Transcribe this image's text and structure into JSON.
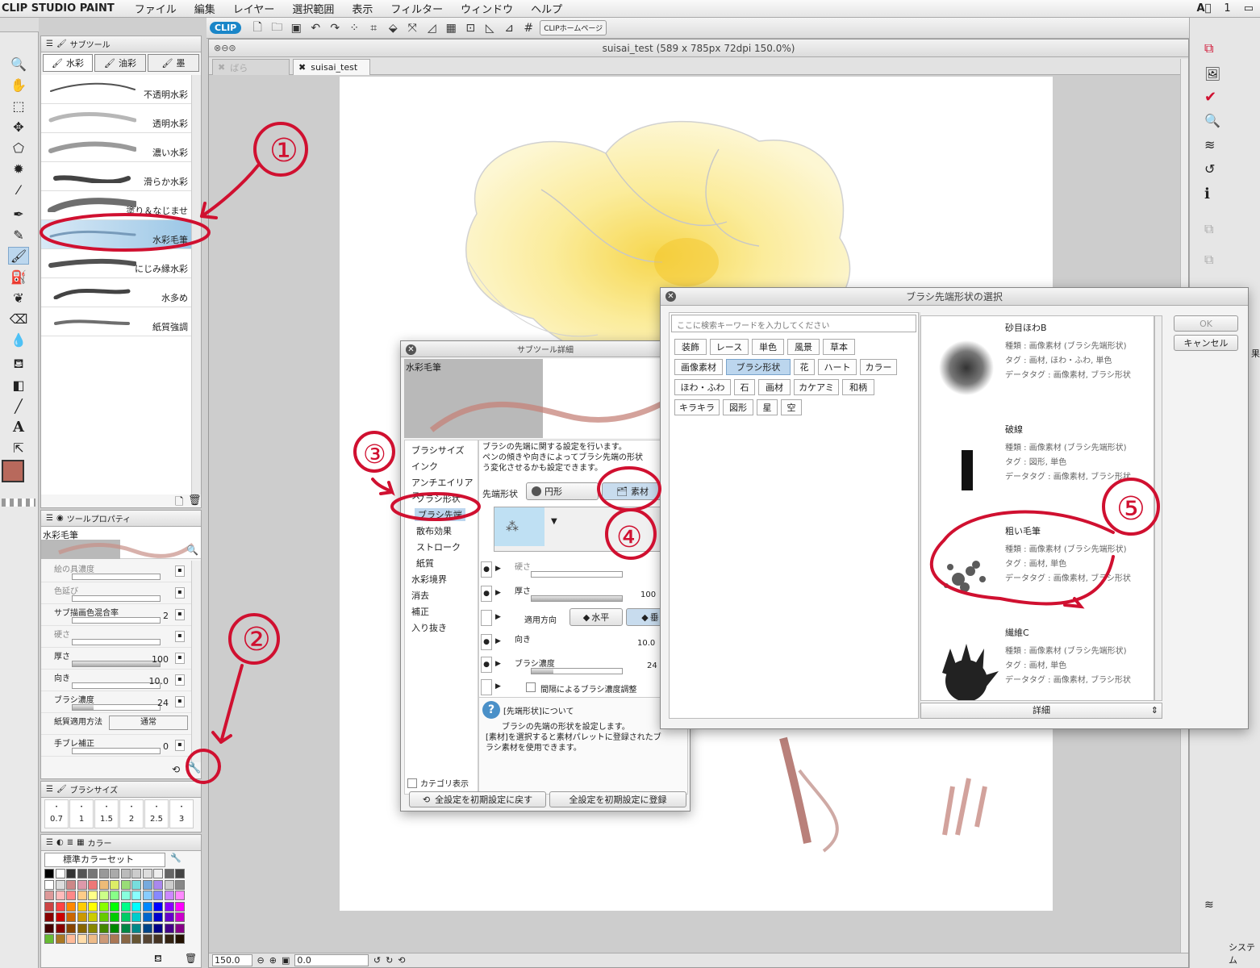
{
  "menubar": {
    "app": "CLIP STUDIO PAINT",
    "items": [
      "ファイル",
      "編集",
      "レイヤー",
      "選択範囲",
      "表示",
      "フィルター",
      "ウィンドウ",
      "ヘルプ"
    ],
    "right_indicator": "1"
  },
  "toolbar": {
    "clip_label": "CLIP",
    "homepage_label": "CLIPホームページ"
  },
  "subtool_panel": {
    "title": "サブツール",
    "groups": [
      "水彩",
      "油彩",
      "墨"
    ],
    "brushes": [
      "不透明水彩",
      "透明水彩",
      "濃い水彩",
      "滑らか水彩",
      "塗り＆なじませ",
      "水彩毛筆",
      "にじみ縁水彩",
      "水多め",
      "紙質強調"
    ],
    "selected_brush": "水彩毛筆"
  },
  "tool_property": {
    "title": "ツールプロパティ",
    "preview_name": "水彩毛筆",
    "rows": [
      {
        "label": "絵の具濃度",
        "value": ""
      },
      {
        "label": "色延び",
        "value": ""
      },
      {
        "label": "サブ描画色混合率",
        "value": "2"
      },
      {
        "label": "硬さ",
        "value": ""
      },
      {
        "label": "厚さ",
        "value": "100"
      },
      {
        "label": "向き",
        "value": "10.0"
      },
      {
        "label": "ブラシ濃度",
        "value": "24"
      },
      {
        "label": "紙質適用方法",
        "value": "通常"
      },
      {
        "label": "手ブレ補正",
        "value": "0"
      }
    ]
  },
  "brush_size_panel": {
    "title": "ブラシサイズ",
    "sizes": [
      "0.7",
      "1",
      "1.5",
      "2",
      "2.5",
      "3"
    ]
  },
  "color_panel": {
    "tab": "カラー",
    "set_name": "標準カラーセット"
  },
  "document": {
    "title": "suisai_test (589 x 785px 72dpi 150.0%)",
    "tabs": [
      "ばら",
      "suisai_test"
    ],
    "zoom": "150.0",
    "angle": "0.0"
  },
  "subtool_detail": {
    "title": "サブツール詳細",
    "preview_name": "水彩毛筆",
    "categories": [
      "ブラシサイズ",
      "インク",
      "アンチエイリアス",
      "ブラシ形状",
      "ブラシ先端",
      "散布効果",
      "ストローク",
      "紙質",
      "水彩境界",
      "消去",
      "補正",
      "入り抜き"
    ],
    "selected_category": "ブラシ先端",
    "description": [
      "ブラシの先端に関する設定を行います。",
      "ペンの傾きや向きによってブラシ先端の形状",
      "う変化させるかも設定できます。"
    ],
    "tip_shape_label": "先端形状",
    "circle_label": "円形",
    "material_label": "素材",
    "params": {
      "hardness": "硬さ",
      "thickness": "厚さ",
      "thickness_value": "100",
      "direction_apply": "適用方向",
      "horizontal": "水平",
      "vertical": "垂",
      "direction": "向き",
      "direction_value": "10.0",
      "brush_density": "ブラシ濃度",
      "brush_density_value": "24",
      "interval_density": "間隔によるブラシ濃度調整"
    },
    "help_title": "[先端形状]について",
    "help_text": [
      "ブラシの先端の形状を設定します。",
      "[素材]を選択すると素材パレットに登録されたブ",
      "ラシ素材を使用できます。"
    ],
    "category_display": "カテゴリ表示",
    "reset_all": "全設定を初期設定に戻す",
    "register_all": "全設定を初期設定に登録"
  },
  "tip_select_dialog": {
    "title": "ブラシ先端形状の選択",
    "search_placeholder": "ここに検索キーワードを入力してください",
    "tags": [
      "装飾",
      "レース",
      "単色",
      "風景",
      "草本",
      "画像素材",
      "ブラシ形状",
      "花",
      "ハート",
      "カラー",
      "ほわ・ふわ",
      "石",
      "画材",
      "カケアミ",
      "和柄",
      "キラキラ",
      "図形",
      "星",
      "空"
    ],
    "selected_tag": "ブラシ形状",
    "materials": [
      {
        "name": "砂目ほわB",
        "kind": "種類 : 画像素材 (ブラシ先端形状)",
        "tag": "タグ : 画材, ほわ・ふわ, 単色",
        "datatag": "データタグ : 画像素材, ブラシ形状"
      },
      {
        "name": "破線",
        "kind": "種類 : 画像素材 (ブラシ先端形状)",
        "tag": "タグ : 図形, 単色",
        "datatag": "データタグ : 画像素材, ブラシ形状"
      },
      {
        "name": "粗い毛筆",
        "kind": "種類 : 画像素材 (ブラシ先端形状)",
        "tag": "タグ : 画材, 単色",
        "datatag": "データタグ : 画像素材, ブラシ形状"
      },
      {
        "name": "繊維C",
        "kind": "種類 : 画像素材 (ブラシ先端形状)",
        "tag": "タグ : 画材, 単色",
        "datatag": "データタグ : 画像素材, ブラシ形状"
      }
    ],
    "detail_label": "詳細",
    "ok": "OK",
    "cancel": "キャンセル"
  },
  "right_panel": {
    "system_label": "システム",
    "fx_label": "果"
  },
  "annotations": [
    "①",
    "②",
    "③",
    "④",
    "⑤"
  ],
  "colors": {
    "accent_red": "#d01030",
    "selection_blue": "#bcd6ee",
    "current_color": "#b8695c"
  }
}
